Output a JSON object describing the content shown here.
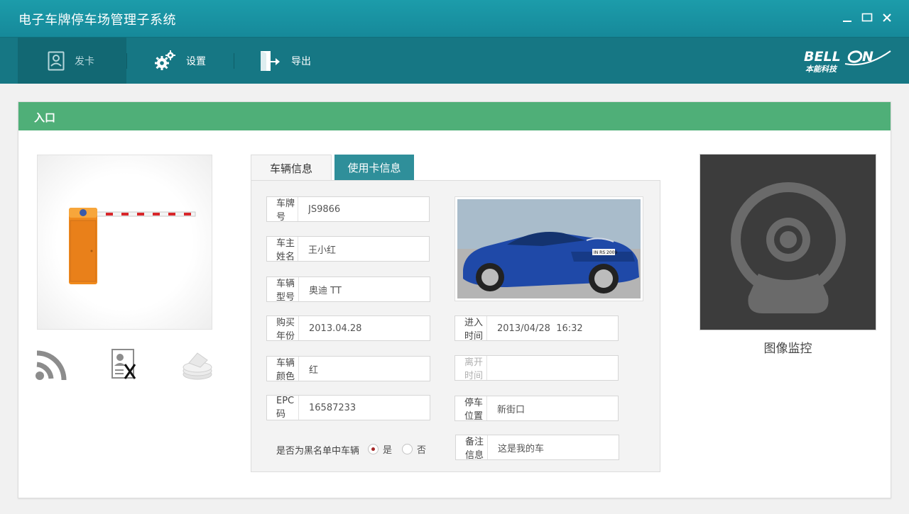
{
  "app": {
    "title": "电子车牌停车场管理子系统"
  },
  "window": {
    "minimize_icon": "minimize-icon",
    "maximize_icon": "maximize-icon",
    "close_icon": "close-icon"
  },
  "toolbar": {
    "items": [
      {
        "label": "发卡",
        "icon": "id-card-icon",
        "active": true
      },
      {
        "label": "设置",
        "icon": "gears-icon",
        "active": false
      },
      {
        "label": "导出",
        "icon": "exit-door-icon",
        "active": false
      }
    ]
  },
  "brand": {
    "name": "BELLON",
    "subtitle": "本能科技"
  },
  "panel": {
    "title": "入口"
  },
  "left": {
    "icons": [
      "rfid-signal-icon",
      "id-card-blocked-icon",
      "card-reader-icon"
    ]
  },
  "tabs": [
    {
      "label": "车辆信息",
      "active": false
    },
    {
      "label": "使用卡信息",
      "active": true
    }
  ],
  "form": {
    "plate": {
      "label": "车牌号",
      "value": "JS9866"
    },
    "owner": {
      "label": "车主姓名",
      "value": "王小红"
    },
    "model": {
      "label": "车辆型号",
      "value": "奥迪 TT"
    },
    "purchase_year": {
      "label": "购买年份",
      "value": "2013.04.28"
    },
    "color": {
      "label": "车辆颜色",
      "value": "红"
    },
    "epc": {
      "label": "EPC码",
      "value": "16587233"
    },
    "enter_time": {
      "label": "进入时间",
      "value": "2013/04/28  16:32"
    },
    "leave_time": {
      "label": "离开时间",
      "value": ""
    },
    "parking_location": {
      "label": "停车位置",
      "value": "新街口"
    },
    "remark": {
      "label": "备注信息",
      "value": "这是我的车"
    },
    "blacklist": {
      "label": "是否为黑名单中车辆",
      "yes": "是",
      "no": "否",
      "selected": "是"
    }
  },
  "car_photo": {
    "plate_text": "IN RS 2009"
  },
  "monitor": {
    "label": "图像监控"
  },
  "colors": {
    "titlebar": "#1c9caa",
    "toolbar": "#167784",
    "panel_header": "#4faf78",
    "active_tab": "#2f8f9a"
  }
}
